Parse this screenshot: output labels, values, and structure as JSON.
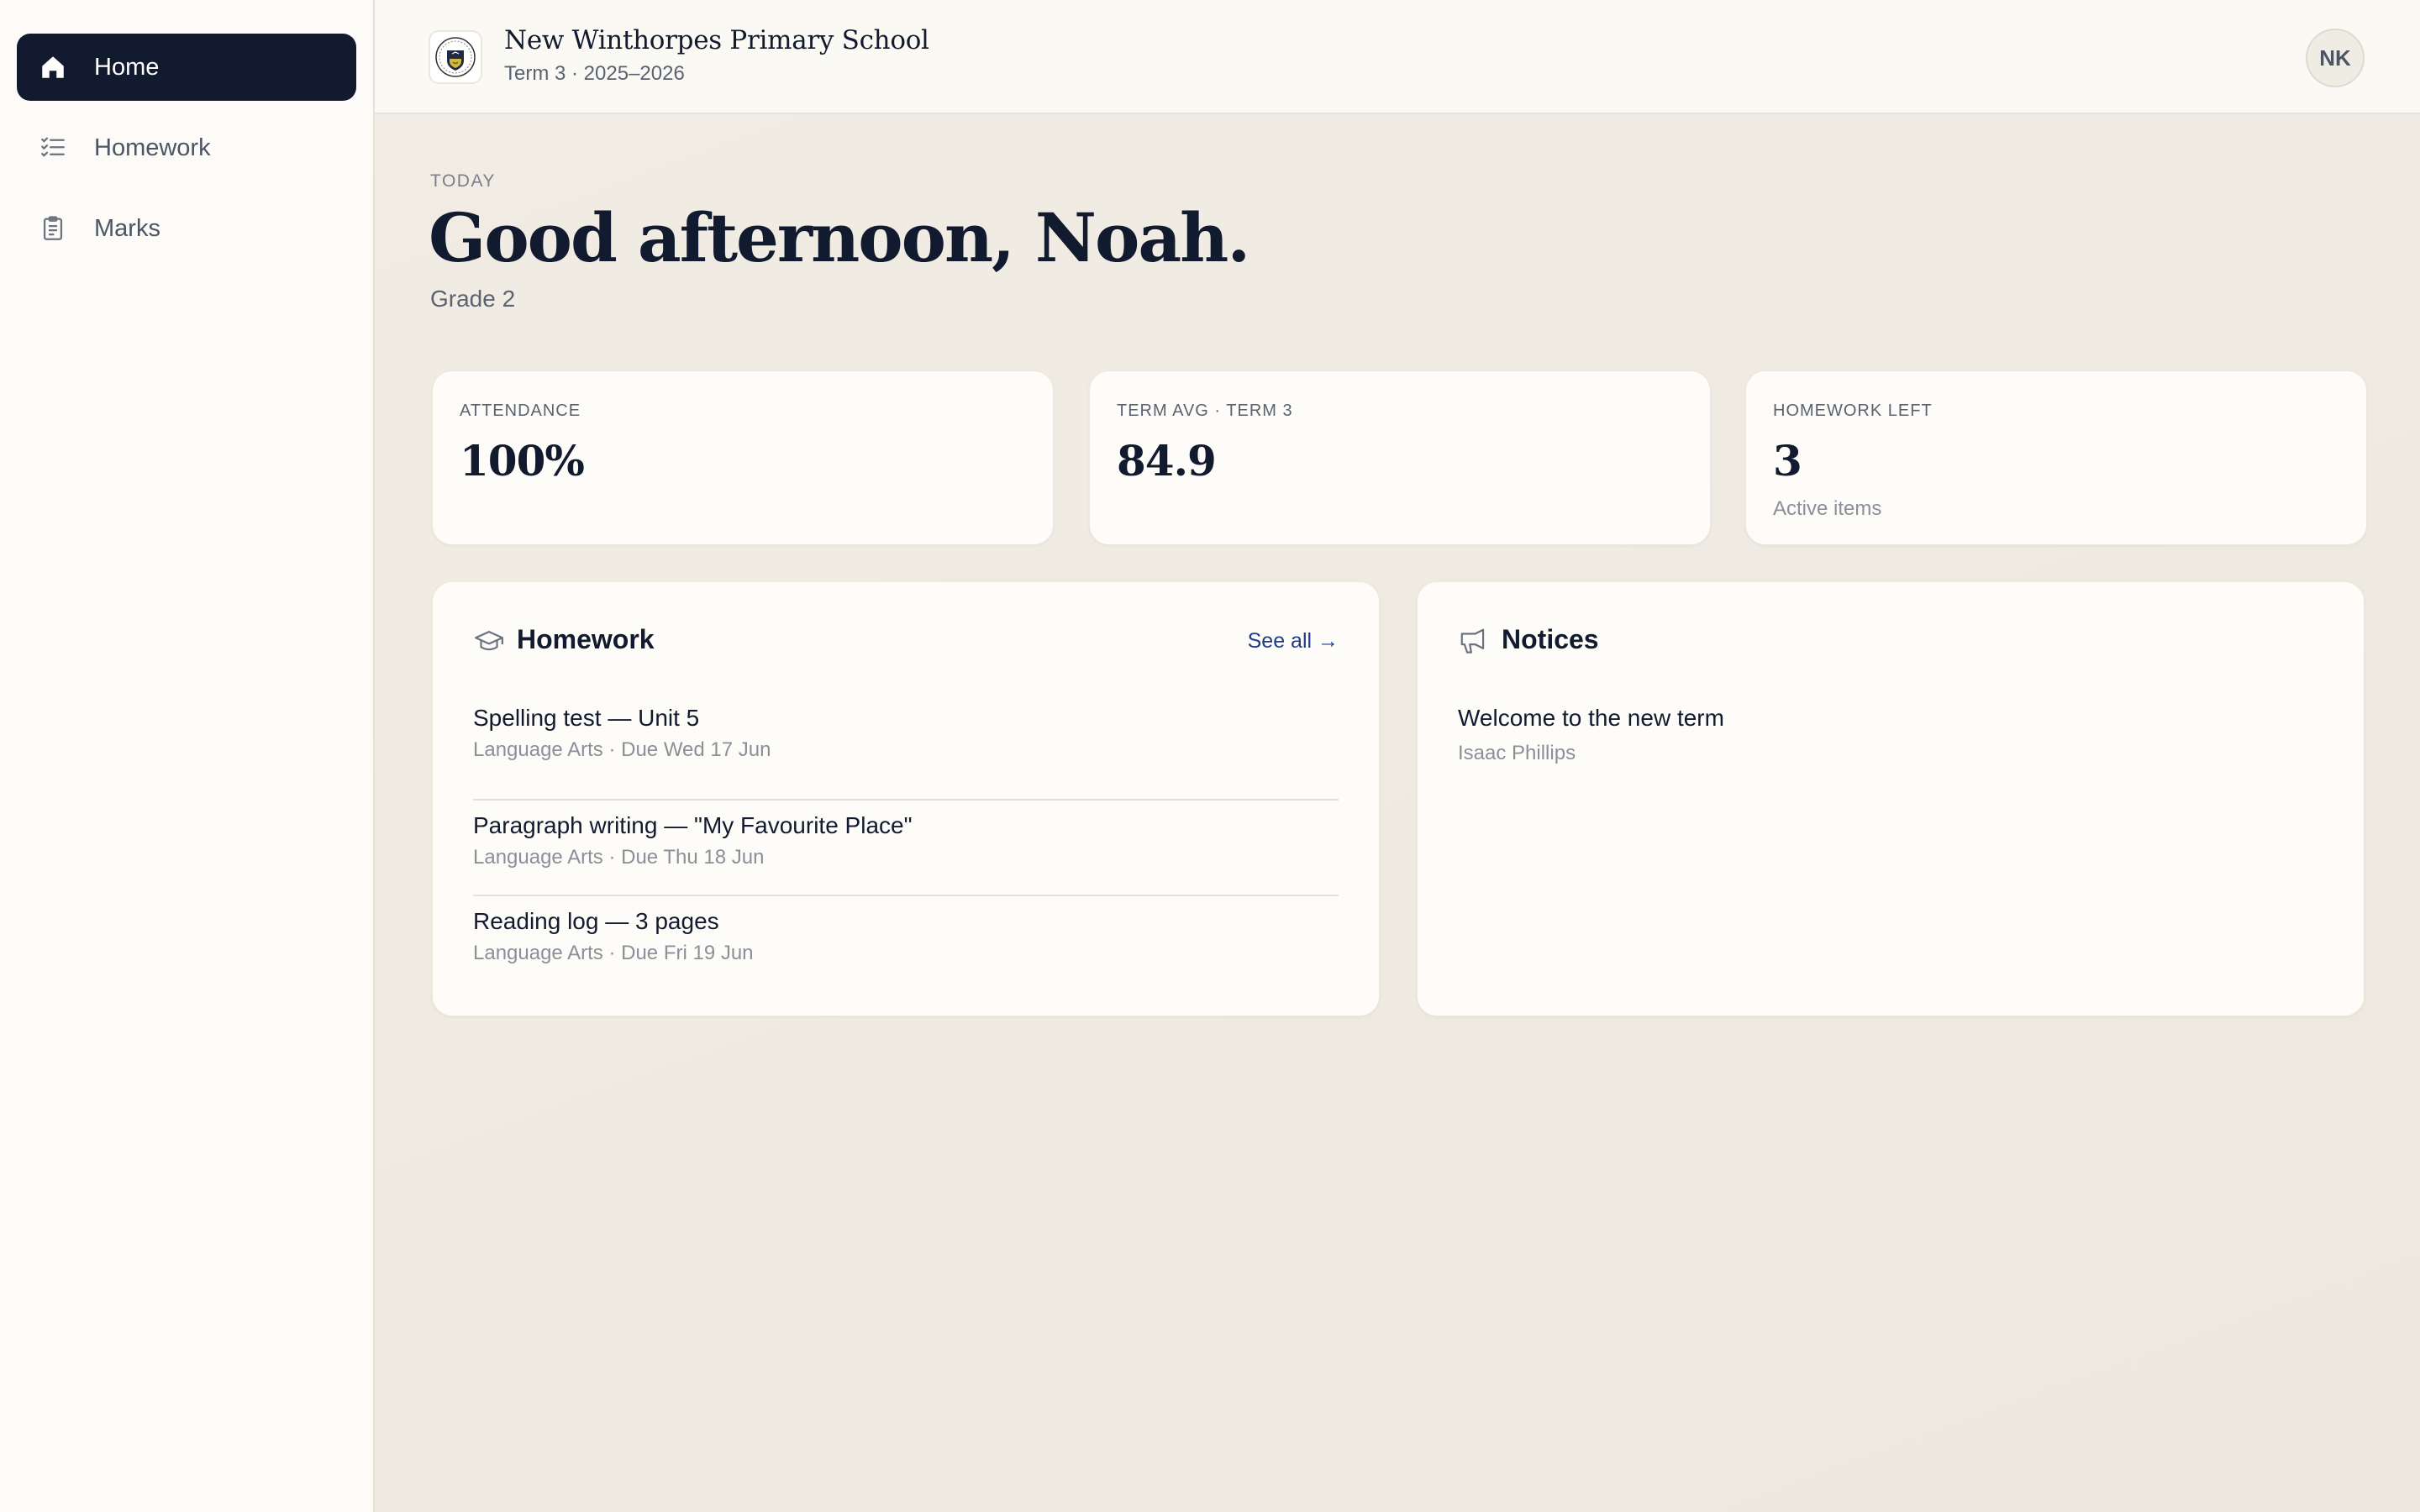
{
  "nav": {
    "items": [
      {
        "label": "Home",
        "icon": "home-icon",
        "active": true
      },
      {
        "label": "Homework",
        "icon": "checklist-icon",
        "active": false
      },
      {
        "label": "Marks",
        "icon": "clipboard-icon",
        "active": false
      }
    ]
  },
  "header": {
    "school_name": "New Winthorpes Primary School",
    "term": "Term 3 · 2025–2026",
    "avatar_initials": "NK",
    "crest_icon": "school-crest-icon"
  },
  "greeting": {
    "today_label": "TODAY",
    "message": "Good afternoon, Noah.",
    "grade": "Grade 2"
  },
  "stats": [
    {
      "label": "ATTENDANCE",
      "value": "100%",
      "sub": ""
    },
    {
      "label": "TERM AVG · TERM 3",
      "value": "84.9",
      "sub": ""
    },
    {
      "label": "HOMEWORK LEFT",
      "value": "3",
      "sub": "Active items"
    }
  ],
  "homework_panel": {
    "title": "Homework",
    "icon": "graduation-cap-icon",
    "see_all": "See all →",
    "items": [
      {
        "title": "Spelling test — Unit 5",
        "meta": "Language Arts · Due Wed 17 Jun"
      },
      {
        "title": "Paragraph writing — \"My Favourite Place\"",
        "meta": "Language Arts · Due Thu 18 Jun"
      },
      {
        "title": "Reading log — 3 pages",
        "meta": "Language Arts · Due Fri 19 Jun"
      }
    ]
  },
  "notices_panel": {
    "title": "Notices",
    "icon": "megaphone-icon",
    "items": [
      {
        "title": "Welcome to the new term",
        "author": "Isaac Phillips"
      }
    ]
  },
  "colors": {
    "navy": "#111a2e",
    "link": "#1e3a8a",
    "muted": "#8a8f98"
  }
}
